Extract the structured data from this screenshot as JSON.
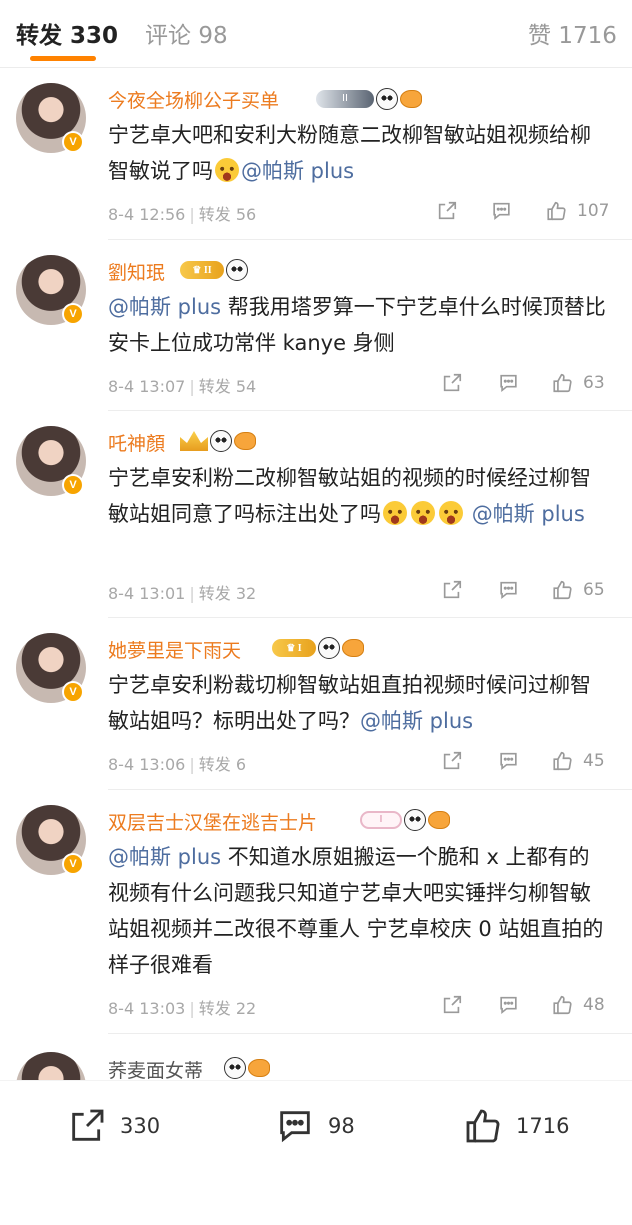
{
  "tabs": {
    "repost_label": "转发",
    "repost_count": "330",
    "comment_label": "评论",
    "comment_count": "98",
    "like_label": "赞",
    "like_count": "1716"
  },
  "comments": [
    {
      "username": "今夜全场柳公子买单",
      "text_parts": [
        "宁艺卓大吧和安利大粉随意二改柳智敏站姐视频给柳智敏说了吗"
      ],
      "mention": "@帕斯 plus",
      "time": "8-4 12:56",
      "repost_label": "转发",
      "repost_count": "56",
      "like_count": "107"
    },
    {
      "username": "劉知珉",
      "mention": "@帕斯 plus",
      "text": "帮我用塔罗算一下宁艺卓什么时候顶替比安卡上位成功常伴 kanye 身侧",
      "time": "8-4 13:07",
      "repost_label": "转发",
      "repost_count": "54",
      "like_count": "63"
    },
    {
      "username": "吒神顏",
      "text": "宁艺卓安利粉二改柳智敏站姐的视频的时候经过柳智敏站姐同意了吗标注出处了吗",
      "mention": "@帕斯 plus",
      "time": "8-4 13:01",
      "repost_label": "转发",
      "repost_count": "32",
      "like_count": "65"
    },
    {
      "username": "她夢里是下雨天",
      "text": "宁艺卓安利粉裁切柳智敏站姐直拍视频时候问过柳智敏站姐吗？标明出处了吗？",
      "mention": "@帕斯 plus",
      "time": "8-4 13:06",
      "repost_label": "转发",
      "repost_count": "6",
      "like_count": "45"
    },
    {
      "username": "双层吉士汉堡在逃吉士片",
      "mention": "@帕斯 plus",
      "text": "不知道水原姐搬运一个脆和 x 上都有的视频有什么问题我只知道宁艺卓大吧实锤拌匀柳智敏站姐视频并二改很不尊重人 宁艺卓校庆 0 站姐直拍的样子很难看",
      "time": "8-4 13:03",
      "repost_label": "转发",
      "repost_count": "22",
      "like_count": "48"
    },
    {
      "username": "荞麦面女蒂"
    }
  ],
  "bottom_bar": {
    "repost_count": "330",
    "comment_count": "98",
    "like_count": "1716"
  },
  "icons": {
    "repost": "share-arrow-icon",
    "comment": "comment-bubble-icon",
    "like": "thumbs-up-icon",
    "verified": "verified-v-badge-icon"
  },
  "colors": {
    "username": "#ec7b1f",
    "mention": "#4e6d9f",
    "accent_underline": "#ff8200"
  }
}
